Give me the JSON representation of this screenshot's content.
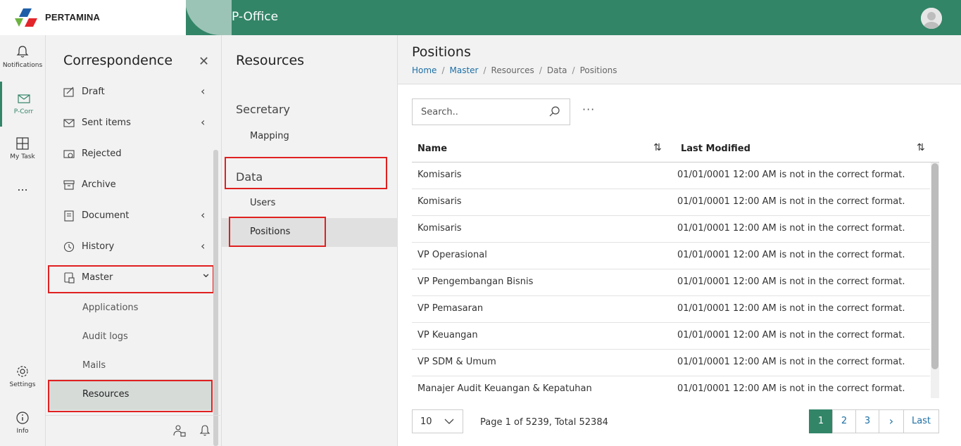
{
  "header": {
    "logo_text": "PERTAMINA",
    "app_title": "P-Office"
  },
  "rail": {
    "items": [
      {
        "label": "Notifications",
        "icon": "bell-icon"
      },
      {
        "label": "P-Corr",
        "icon": "mail-icon"
      },
      {
        "label": "My Task",
        "icon": "layout-icon"
      },
      {
        "label": "...",
        "icon": "more-icon"
      },
      {
        "label": "Settings",
        "icon": "gear-icon"
      },
      {
        "label": "Info",
        "icon": "info-icon"
      }
    ]
  },
  "correspondence": {
    "title": "Correspondence",
    "menu": [
      {
        "label": "Draft",
        "icon": "draft-icon",
        "chevron": "‹"
      },
      {
        "label": "Sent items",
        "icon": "sent-icon",
        "chevron": "‹"
      },
      {
        "label": "Rejected",
        "icon": "rejected-icon",
        "chevron": ""
      },
      {
        "label": "Archive",
        "icon": "archive-icon",
        "chevron": ""
      },
      {
        "label": "Document",
        "icon": "document-icon",
        "chevron": "‹"
      },
      {
        "label": "History",
        "icon": "history-icon",
        "chevron": "‹"
      },
      {
        "label": "Master",
        "icon": "master-icon",
        "chevron": "⌄"
      }
    ],
    "submenu": [
      "Applications",
      "Audit logs",
      "Mails",
      "Resources"
    ]
  },
  "resources": {
    "title": "Resources",
    "group1": "Secretary",
    "group1_items": [
      "Mapping"
    ],
    "group2": "Data",
    "group2_items": [
      "Users",
      "Positions"
    ]
  },
  "main": {
    "title": "Positions",
    "breadcrumb": [
      "Home",
      "Master",
      "Resources",
      "Data",
      "Positions"
    ],
    "search_placeholder": "Search..",
    "more_label": "···",
    "columns": [
      "Name",
      "Last Modified"
    ],
    "rows": [
      {
        "name": "Komisaris",
        "modified": "01/01/0001 12:00 AM is not in the correct format."
      },
      {
        "name": "Komisaris",
        "modified": "01/01/0001 12:00 AM is not in the correct format."
      },
      {
        "name": "Komisaris",
        "modified": "01/01/0001 12:00 AM is not in the correct format."
      },
      {
        "name": "VP Operasional",
        "modified": "01/01/0001 12:00 AM is not in the correct format."
      },
      {
        "name": "VP Pengembangan Bisnis",
        "modified": "01/01/0001 12:00 AM is not in the correct format."
      },
      {
        "name": "VP Pemasaran",
        "modified": "01/01/0001 12:00 AM is not in the correct format."
      },
      {
        "name": "VP Keuangan",
        "modified": "01/01/0001 12:00 AM is not in the correct format."
      },
      {
        "name": "VP SDM & Umum",
        "modified": "01/01/0001 12:00 AM is not in the correct format."
      },
      {
        "name": "Manajer Audit Keuangan & Kepatuhan",
        "modified": "01/01/0001 12:00 AM is not in the correct format."
      }
    ],
    "page_size": "10",
    "page_info": "Page 1 of 5239, Total 52384",
    "pages": [
      "1",
      "2",
      "3",
      "›",
      "Last"
    ]
  },
  "colors": {
    "brand_green": "#338568",
    "highlight_red": "#e02020",
    "link_blue": "#1d6fa5"
  }
}
